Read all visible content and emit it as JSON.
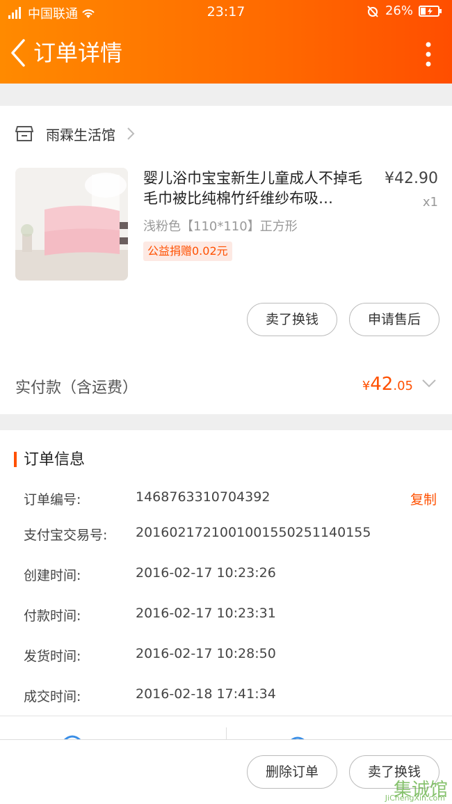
{
  "status_bar": {
    "carrier": "中国联通",
    "time": "23:17",
    "battery": "26%"
  },
  "nav": {
    "title": "订单详情"
  },
  "shop": {
    "name": "雨霖生活馆"
  },
  "product": {
    "title": "婴儿浴巾宝宝新生儿童成人不掉毛毛巾被比纯棉竹纤维纱布吸…",
    "price": "¥42.90",
    "quantity": "x1",
    "sku": "浅粉色【110*110】正方形",
    "charity_badge": "公益捐赠0.02元"
  },
  "actions": {
    "sell_label": "卖了换钱",
    "after_sale_label": "申请售后"
  },
  "total": {
    "label": "实付款（含运费）",
    "currency": "¥",
    "integer": "42",
    "decimal": ".05"
  },
  "order_info": {
    "title": "订单信息",
    "copy_label": "复制",
    "rows": [
      {
        "label": "订单编号:",
        "value": "1468763310704392"
      },
      {
        "label": "支付宝交易号:",
        "value": "2016021721001001550251140155"
      },
      {
        "label": "创建时间:",
        "value": "2016-02-17 10:23:26"
      },
      {
        "label": "付款时间:",
        "value": "2016-02-17 10:23:31"
      },
      {
        "label": "发货时间:",
        "value": "2016-02-17 10:28:50"
      },
      {
        "label": "成交时间:",
        "value": "2016-02-18 17:41:34"
      }
    ]
  },
  "bottom": {
    "delete_label": "删除订单",
    "sell_label": "卖了换钱"
  },
  "watermark": {
    "text": "集诚馆",
    "sub": "JiChengXin.com"
  },
  "colors": {
    "accent": "#ff5000",
    "header_start": "#ff8a00",
    "header_end": "#ff4e00"
  }
}
